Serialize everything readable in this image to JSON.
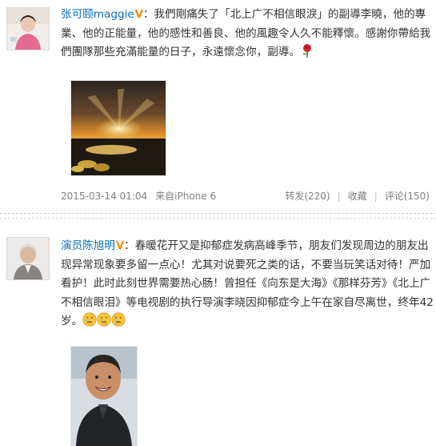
{
  "posts": [
    {
      "username": "张可颐maggie",
      "verified_badge": "V",
      "colon": "：",
      "text": "我們剛痛失了「北上广不相信眼淚」的副導李曉，他的專業、他的正能量，他的感性和善良、他的風趣令人久不能釋懷。感謝你帶給我們團隊那些充滿能量的日子，永遠懷念你，副導。",
      "emoji": "rose-icon",
      "image": "sunset-field-photo",
      "time": "2015-03-14 01:04",
      "source_label": "来自",
      "source": "iPhone 6",
      "repost": "转发(220)",
      "separator": "|",
      "favorite": "收藏",
      "comment": "评论(150)"
    },
    {
      "username": "演员陈旭明",
      "verified_badge": "V",
      "colon": "：",
      "text": "春暖花开又是抑郁症发病高峰季节，朋友们发现周边的朋友出现异常现象要多留一点心！尤其对说要死之类的话，不要当玩笑话对待！严加看护！此时此刻世界需要热心肠！曾担任《向东是大海》《那样芬芳》《北上广不相信眼泪》等电视剧的执行导演李晓因抑郁症今上午在家自尽离世，终年42岁。",
      "emojis": [
        "sad-face-icon",
        "sad-face-icon",
        "sad-face-icon"
      ],
      "image": "smiling-man-photo"
    }
  ],
  "colors": {
    "username": "#0a6fbf",
    "badge": "#ff8a00",
    "text": "#333333",
    "meta": "#808080"
  }
}
